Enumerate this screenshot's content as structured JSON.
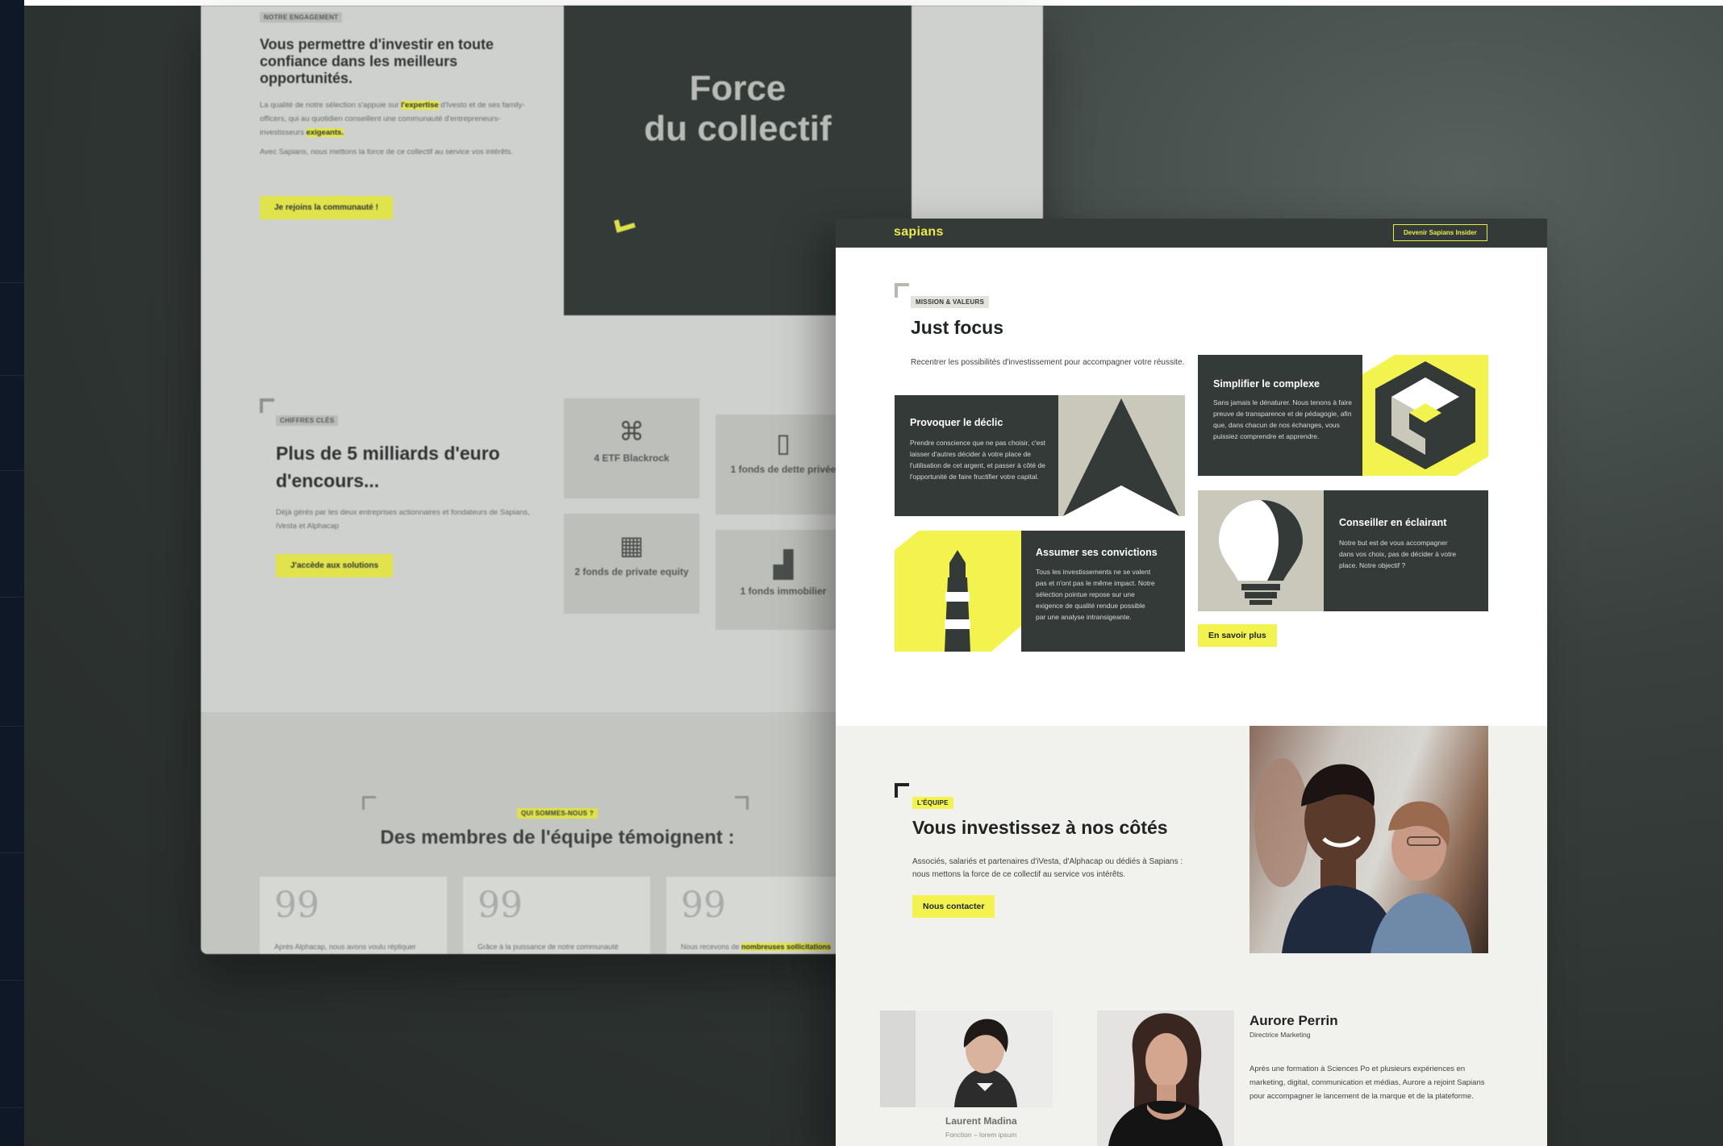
{
  "back_page": {
    "engagement": {
      "eyebrow": "NOTRE ENGAGEMENT",
      "title": "Vous permettre d'investir en toute confiance dans les meilleurs opportunités.",
      "p1_a": "La qualité de notre sélection s'appuie sur ",
      "p1_hl": "l'expertise",
      "p1_b": " d'Ivesto et de ses family-officers, qui au quotidien conseillent une communauté d'entrepreneurs-investisseurs ",
      "p1_hl2": "exigeants.",
      "p2": "Avec Sapians, nous mettons la force de ce collectif au service vos intérêts.",
      "cta": "Je rejoins la communauté !"
    },
    "hero": {
      "line1": "Force",
      "line2": "du collectif"
    },
    "figures": {
      "eyebrow": "CHIFFRES CLÉS",
      "title": "Plus de 5 milliards d'euro d'encours...",
      "text": "Déjà gérés par les deux entreprises actionnaires et fondateurs de Sapians, iVesta et Alphacap",
      "cta": "J'accède aux solutions",
      "cards": [
        {
          "label": "4 ETF Blackrock",
          "icon": "network-icon"
        },
        {
          "label": "1 fonds de dette privée",
          "icon": "document-coin-icon"
        },
        {
          "label": "2 fonds de private equity",
          "icon": "grid-coin-icon"
        },
        {
          "label": "1 fonds immobilier",
          "icon": "building-icon"
        }
      ]
    },
    "team": {
      "eyebrow": "QUI SOMMES-NOUS ?",
      "title": "Des membres de l'équipe témoignent :",
      "quotes": [
        {
          "mark": "99",
          "text": "Après Alphacap, nous avons voulu répliquer"
        },
        {
          "mark": "99",
          "text": "Grâce à la puissance de notre communauté"
        },
        {
          "mark": "99",
          "text_a": "Nous recevons de ",
          "text_hl": "nombreuses sollicitations"
        }
      ]
    }
  },
  "front_page": {
    "brand": "sapians",
    "nav_cta": "Devenir Sapians Insider",
    "mission": {
      "eyebrow": "MISSION & VALEURS",
      "title": "Just focus",
      "lead": "Recentrer les possibilités d'investissement pour accompagner votre réussite.",
      "cta": "En savoir plus",
      "tiles": [
        {
          "title": "Simplifier le complexe",
          "text": "Sans jamais le dénaturer. Nous tenons à faire preuve de transparence et de pédagogie, afin que, dans chacun de nos échanges, vous puissiez comprendre et apprendre."
        },
        {
          "title": "Provoquer le déclic",
          "text": "Prendre conscience que ne pas choisir, c'est laisser d'autres décider à votre place de l'utilisation de cet argent, et passer à côté de l'opportunité de faire fructifier votre capital."
        },
        {
          "title": "Assumer ses convictions",
          "text": "Tous les investissements ne se valent pas et n'ont pas le même impact. Notre sélection pointue repose sur une exigence de qualité rendue possible par une analyse intransigeante."
        },
        {
          "title": "Conseiller en éclairant",
          "text": "Notre but est de vous accompagner dans vos choix, pas de décider à votre place. Notre objectif ?"
        }
      ]
    },
    "team": {
      "eyebrow": "L'ÉQUIPE",
      "title": "Vous investissez à nos côtés",
      "lead": "Associés, salariés et partenaires d'iVesta, d'Alphacap ou dédiés à Sapians : nous mettons la force de ce collectif au service vos intérêts.",
      "cta": "Nous contacter"
    },
    "members": [
      {
        "name": "Laurent Madina",
        "role": "Fonction – lorem ipsum"
      },
      {
        "name": "Aurore Perrin",
        "role": "Directrice Marketing",
        "bio": "Après une formation à Sciences Po et plusieurs expériences en marketing, digital, communication et médias, Aurore a rejoint Sapians pour accompagner le lancement de la marque et de la plateforme."
      }
    ]
  },
  "colors": {
    "accent_yellow": "#f2f34e",
    "dark_green": "#343a38",
    "taupe": "#c9c8bb",
    "background": "#2b312f"
  }
}
